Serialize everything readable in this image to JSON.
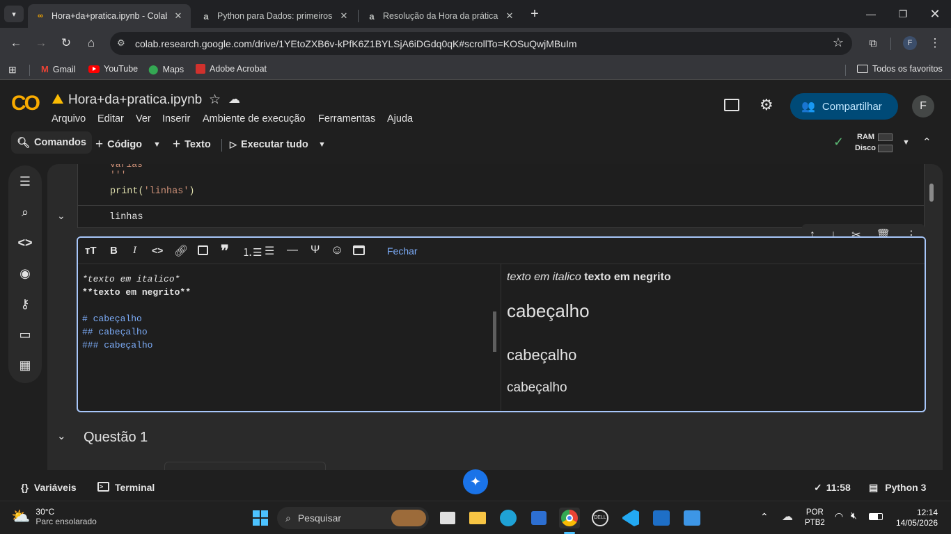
{
  "browser": {
    "tabs": [
      {
        "title": "Hora+da+pratica.ipynb - Colab",
        "icon": "colab-icon",
        "active": true
      },
      {
        "title": "Python para Dados: primeiros p",
        "icon": "alura-icon",
        "active": false
      },
      {
        "title": "Resolução da Hora da prática -",
        "icon": "alura-icon",
        "active": false
      }
    ],
    "new_tab": "+",
    "url": "colab.research.google.com/drive/1YEtoZXB6v-kPfK6Z1BYLSjA6iDGdq0qK#scrollTo=KOSuQwjMBuIm",
    "profile_initial": "F",
    "bookmarks": [
      {
        "label": "Gmail",
        "icon": "gmail-icon"
      },
      {
        "label": "YouTube",
        "icon": "youtube-icon"
      },
      {
        "label": "Maps",
        "icon": "maps-icon"
      },
      {
        "label": "Adobe Acrobat",
        "icon": "acrobat-icon"
      }
    ],
    "all_bookmarks": "Todos os favoritos"
  },
  "colab": {
    "logo": "CO",
    "notebook_title": "Hora+da+pratica.ipynb",
    "menu": [
      "Arquivo",
      "Editar",
      "Ver",
      "Inserir",
      "Ambiente de execução",
      "Ferramentas",
      "Ajuda"
    ],
    "share_label": "Compartilhar",
    "user_initial": "F",
    "toolbar": {
      "commands": "Comandos",
      "code": "Código",
      "text": "Texto",
      "run_all": "Executar tudo",
      "ram": "RAM",
      "disk": "Disco"
    }
  },
  "code_cell": {
    "partial_line": "varias",
    "quote_line": "'''",
    "print_line": "print('linhas')",
    "output": "linhas"
  },
  "text_cell": {
    "close_label": "Fechar",
    "editor_lines": [
      "*texto em italico*",
      "**texto em negrito**",
      "",
      "# cabeçalho",
      "## cabeçalho",
      "### cabeçalho"
    ],
    "preview": {
      "italic": "texto em italico",
      "bold": "texto em negrito",
      "h1": "cabeçalho",
      "h2": "cabeçalho",
      "h3": "cabeçalho"
    }
  },
  "section": {
    "title": "Questão 1"
  },
  "bottom": {
    "variables": "Variáveis",
    "terminal": "Terminal",
    "exec_time": "11:58",
    "runtime": "Python 3"
  },
  "taskbar": {
    "temperature": "30°C",
    "weather": "Parc ensolarado",
    "search_placeholder": "Pesquisar",
    "lang1": "POR",
    "lang2": "PTB2",
    "time": "12:14",
    "date": "14/05/2026"
  },
  "colors": {
    "accent_blue": "#7cacf8",
    "share_bg": "#004a77",
    "colab_orange": "#f9ab00",
    "active_border": "#a8c7fa"
  }
}
